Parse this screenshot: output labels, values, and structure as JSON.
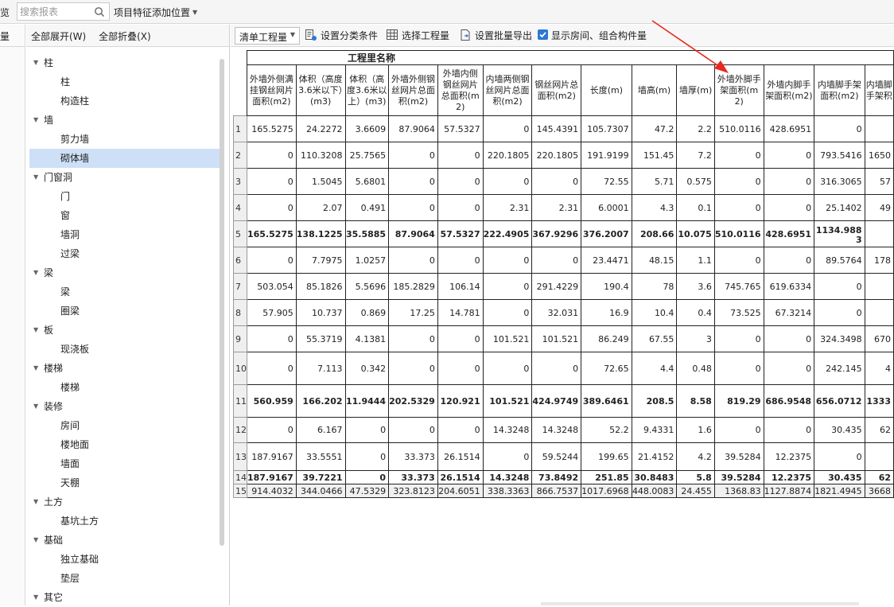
{
  "topbar": {
    "cut_label": "览",
    "search_placeholder": "搜索报表",
    "position_dropdown": "项目特征添加位置"
  },
  "leftslim": {
    "header": "量"
  },
  "tree_toolbar": {
    "expand_all": "全部展开(W)",
    "collapse_all": "全部折叠(X)"
  },
  "tree": [
    {
      "label": "柱",
      "children": [
        "柱",
        "构造柱"
      ]
    },
    {
      "label": "墙",
      "children": [
        "剪力墙",
        "砌体墙"
      ]
    },
    {
      "label": "门窗洞",
      "children": [
        "门",
        "窗",
        "墙洞",
        "过梁"
      ]
    },
    {
      "label": "梁",
      "children": [
        "梁",
        "圈梁"
      ]
    },
    {
      "label": "板",
      "children": [
        "现浇板"
      ]
    },
    {
      "label": "楼梯",
      "children": [
        "楼梯"
      ]
    },
    {
      "label": "装修",
      "children": [
        "房间",
        "楼地面",
        "墙面",
        "天棚"
      ]
    },
    {
      "label": "土方",
      "children": [
        "基坑土方"
      ]
    },
    {
      "label": "基础",
      "children": [
        "独立基础",
        "垫层"
      ]
    },
    {
      "label": "其它",
      "children": []
    }
  ],
  "tree_selected": "砌体墙",
  "toolbar": {
    "list_dropdown": "清单工程量",
    "set_category": "设置分类条件",
    "select_quantity": "选择工程量",
    "set_batch_export": "设置批量导出",
    "show_rooms": "显示房间、组合构件量"
  },
  "table": {
    "title": "工程里名称",
    "headers": [
      "外墙外侧满挂钢丝网片面积(m2)",
      "体积（高度3.6米以下）(m3)",
      "体积（高度3.6米以上）(m3)",
      "外墙外侧钢丝网片总面积(m2)",
      "外墙内侧钢丝网片总面积(m2)",
      "内墙两侧钢丝网片总面积(m2)",
      "钢丝网片总面积(m2)",
      "长度(m)",
      "墙高(m)",
      "墙厚(m)",
      "外墙外脚手架面积(m2)",
      "外墙内脚手架面积(m2)",
      "内墙脚手架面积(m2)",
      "内墙脚手架积"
    ],
    "rows": [
      {
        "n": "1",
        "bold": false,
        "cells": [
          "165.5275",
          "24.2272",
          "3.6609",
          "87.9064",
          "57.5327",
          "0",
          "145.4391",
          "105.7307",
          "47.2",
          "2.2",
          "510.0116",
          "428.6951",
          "0",
          ""
        ]
      },
      {
        "n": "2",
        "bold": false,
        "cells": [
          "0",
          "110.3208",
          "25.7565",
          "0",
          "0",
          "220.1805",
          "220.1805",
          "191.9199",
          "151.45",
          "7.2",
          "0",
          "0",
          "793.5416",
          "1650"
        ]
      },
      {
        "n": "3",
        "bold": false,
        "cells": [
          "0",
          "1.5045",
          "5.6801",
          "0",
          "0",
          "0",
          "0",
          "72.55",
          "5.71",
          "0.575",
          "0",
          "0",
          "316.3065",
          "57"
        ]
      },
      {
        "n": "4",
        "bold": false,
        "cells": [
          "0",
          "2.07",
          "0.491",
          "0",
          "0",
          "2.31",
          "2.31",
          "6.0001",
          "4.3",
          "0.1",
          "0",
          "0",
          "25.1402",
          "49"
        ]
      },
      {
        "n": "5",
        "bold": true,
        "cells": [
          "165.5275",
          "138.1225",
          "35.5885",
          "87.9064",
          "57.5327",
          "222.4905",
          "367.9296",
          "376.2007",
          "208.66",
          "10.075",
          "510.0116",
          "428.6951",
          "1134.9883",
          ""
        ]
      },
      {
        "n": "6",
        "bold": false,
        "cells": [
          "0",
          "7.7975",
          "1.0257",
          "0",
          "0",
          "0",
          "0",
          "23.4471",
          "48.15",
          "1.1",
          "0",
          "0",
          "89.5764",
          "178"
        ]
      },
      {
        "n": "7",
        "bold": false,
        "cells": [
          "503.054",
          "85.1826",
          "5.5696",
          "185.2829",
          "106.14",
          "0",
          "291.4229",
          "190.4",
          "78",
          "3.6",
          "745.765",
          "619.6334",
          "0",
          ""
        ]
      },
      {
        "n": "8",
        "bold": false,
        "cells": [
          "57.905",
          "10.737",
          "0.869",
          "17.25",
          "14.781",
          "0",
          "32.031",
          "16.9",
          "10.4",
          "0.4",
          "73.525",
          "67.3214",
          "0",
          ""
        ]
      },
      {
        "n": "9",
        "bold": false,
        "cells": [
          "0",
          "55.3719",
          "4.1381",
          "0",
          "0",
          "101.521",
          "101.521",
          "86.249",
          "67.55",
          "3",
          "0",
          "0",
          "324.3498",
          "670"
        ]
      },
      {
        "n": "10",
        "bold": false,
        "cells": [
          "0",
          "7.113",
          "0.342",
          "0",
          "0",
          "0",
          "0",
          "72.65",
          "4.4",
          "0.48",
          "0",
          "0",
          "242.145",
          "4"
        ]
      },
      {
        "n": "11",
        "bold": true,
        "cells": [
          "560.959",
          "166.202",
          "11.9444",
          "202.5329",
          "120.921",
          "101.521",
          "424.9749",
          "389.6461",
          "208.5",
          "8.58",
          "819.29",
          "686.9548",
          "656.0712",
          "1333"
        ]
      },
      {
        "n": "12",
        "bold": false,
        "cells": [
          "0",
          "6.167",
          "0",
          "0",
          "0",
          "14.3248",
          "14.3248",
          "52.2",
          "9.4331",
          "1.6",
          "0",
          "0",
          "30.435",
          "62"
        ]
      },
      {
        "n": "13",
        "bold": false,
        "cells": [
          "187.9167",
          "33.5551",
          "0",
          "33.373",
          "26.1514",
          "0",
          "59.5244",
          "199.65",
          "21.4152",
          "4.2",
          "39.5284",
          "12.2375",
          "0",
          ""
        ]
      },
      {
        "n": "14",
        "bold": true,
        "cells": [
          "187.9167",
          "39.7221",
          "0",
          "33.373",
          "26.1514",
          "14.3248",
          "73.8492",
          "251.85",
          "30.8483",
          "5.8",
          "39.5284",
          "12.2375",
          "30.435",
          "62"
        ]
      },
      {
        "n": "15",
        "bold": false,
        "total": true,
        "cells": [
          "914.4032",
          "344.0466",
          "47.5329",
          "323.8123",
          "204.6051",
          "338.3363",
          "866.7537",
          "1017.6968",
          "448.0083",
          "24.455",
          "1368.83",
          "1127.8874",
          "1821.4945",
          "3668"
        ]
      }
    ]
  },
  "colors": {
    "selected_row": "#cde0f7",
    "checkbox": "#2b78d6",
    "annotation_arrow": "#e8281e"
  }
}
